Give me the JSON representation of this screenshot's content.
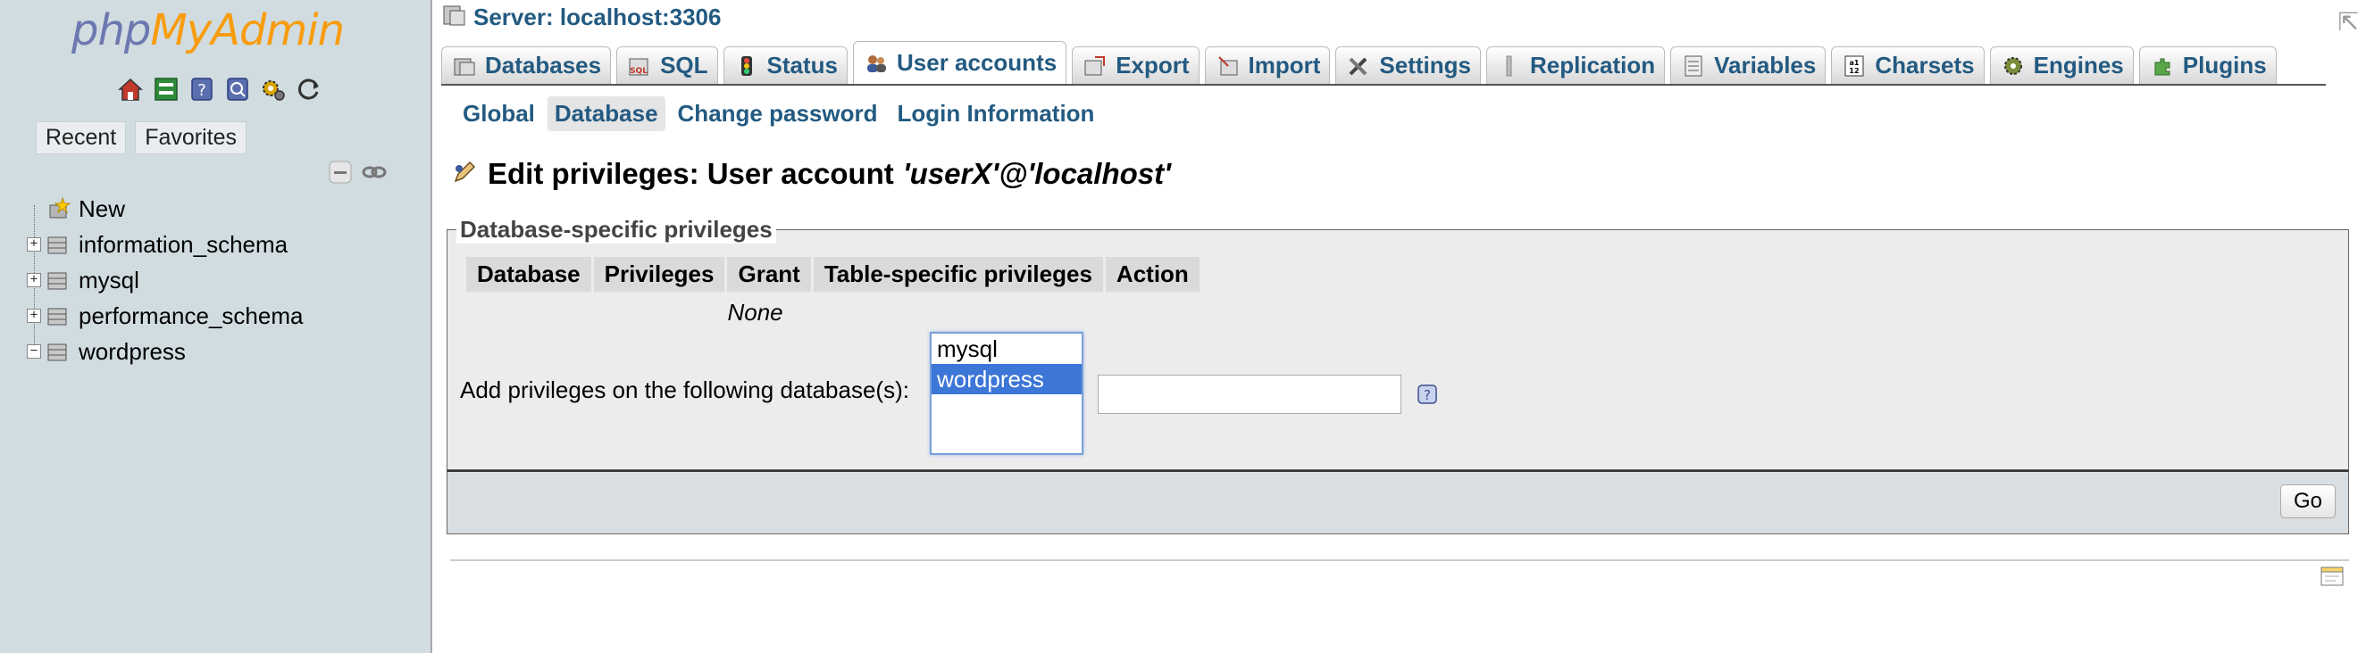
{
  "nav": {
    "logo_php": "php",
    "logo_admin": "MyAdmin",
    "icons": [
      "home-icon",
      "logout-icon",
      "docs-icon",
      "sql-docs-icon",
      "settings-icon",
      "reload-icon"
    ],
    "recent_label": "Recent",
    "favorites_label": "Favorites",
    "tree": [
      {
        "label": "New",
        "icon": "new-db-icon",
        "expander": ""
      },
      {
        "label": "information_schema",
        "icon": "database-icon",
        "expander": "+"
      },
      {
        "label": "mysql",
        "icon": "database-icon",
        "expander": "+"
      },
      {
        "label": "performance_schema",
        "icon": "database-icon",
        "expander": "+"
      },
      {
        "label": "wordpress",
        "icon": "database-icon",
        "expander": "−"
      }
    ]
  },
  "server": {
    "label": "Server: localhost:3306"
  },
  "tabs": [
    {
      "label": "Databases",
      "icon": "databases-icon",
      "active": false
    },
    {
      "label": "SQL",
      "icon": "sql-icon",
      "active": false
    },
    {
      "label": "Status",
      "icon": "status-icon",
      "active": false
    },
    {
      "label": "User accounts",
      "icon": "users-icon",
      "active": true
    },
    {
      "label": "Export",
      "icon": "export-icon",
      "active": false
    },
    {
      "label": "Import",
      "icon": "import-icon",
      "active": false
    },
    {
      "label": "Settings",
      "icon": "settings-icon",
      "active": false
    },
    {
      "label": "Replication",
      "icon": "replication-icon",
      "active": false
    },
    {
      "label": "Variables",
      "icon": "variables-icon",
      "active": false
    },
    {
      "label": "Charsets",
      "icon": "charsets-icon",
      "active": false
    },
    {
      "label": "Engines",
      "icon": "engines-icon",
      "active": false
    },
    {
      "label": "Plugins",
      "icon": "plugins-icon",
      "active": false
    }
  ],
  "subtabs": [
    {
      "label": "Global",
      "active": false
    },
    {
      "label": "Database",
      "active": true
    },
    {
      "label": "Change password",
      "active": false
    },
    {
      "label": "Login Information",
      "active": false
    }
  ],
  "heading": {
    "prefix": "Edit privileges: User account",
    "account": "'userX'@'localhost'"
  },
  "fieldset": {
    "legend": "Database-specific privileges",
    "columns": [
      "Database",
      "Privileges",
      "Grant",
      "Table-specific privileges",
      "Action"
    ],
    "empty_text": "None",
    "add_label": "Add privileges on the following database(s):",
    "db_options": [
      "mysql",
      "wordpress"
    ],
    "selected_option": "wordpress",
    "db_input_value": ""
  },
  "footer": {
    "go_label": "Go"
  },
  "colors": {
    "nav_bg": "#d0dce0",
    "link": "#235a81",
    "selected": "#3c76d6",
    "logo_php": "#6c78af",
    "logo_admin": "#f89c0e"
  }
}
